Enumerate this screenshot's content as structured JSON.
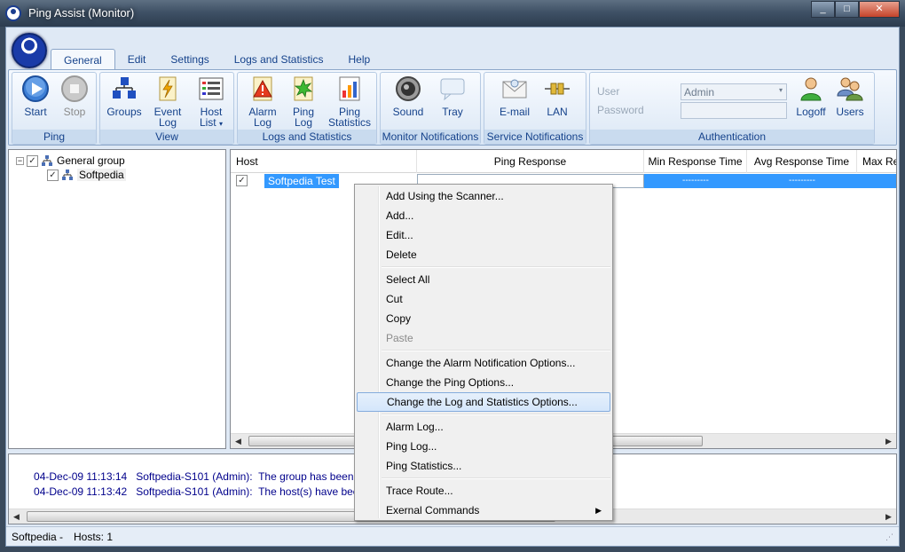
{
  "window": {
    "title": "Ping Assist  (Monitor)",
    "controls": [
      "_",
      "□",
      "✕"
    ]
  },
  "tabs": [
    {
      "label": "General",
      "active": true
    },
    {
      "label": "Edit"
    },
    {
      "label": "Settings"
    },
    {
      "label": "Logs and Statistics"
    },
    {
      "label": "Help"
    }
  ],
  "ribbon": {
    "groups": {
      "ping": "Ping",
      "view": "View",
      "logs": "Logs and Statistics",
      "monitor": "Monitor Notifications",
      "service": "Service Notifications",
      "auth": "Authentication"
    },
    "buttons": {
      "start": "Start",
      "stop": "Stop",
      "groups": "Groups",
      "event_log_1": "Event",
      "event_log_2": "Log",
      "host_list_1": "Host",
      "host_list_2": "List",
      "alarm_log_1": "Alarm",
      "alarm_log_2": "Log",
      "ping_log_1": "Ping",
      "ping_log_2": "Log",
      "ping_stats_1": "Ping",
      "ping_stats_2": "Statistics",
      "sound": "Sound",
      "tray": "Tray",
      "email": "E-mail",
      "lan": "LAN",
      "logoff": "Logoff",
      "users": "Users"
    },
    "auth": {
      "user_label": "User",
      "password_label": "Password",
      "user_value": "Admin",
      "password_value": ""
    }
  },
  "tree": {
    "root": "General group",
    "child": "Softpedia"
  },
  "grid": {
    "columns": [
      "Host",
      "Ping Response",
      "Min Response Time",
      "Avg Response Time",
      "Max Re"
    ],
    "rows": [
      {
        "host": "Softpedia Test",
        "ping_response": "",
        "min": "---------",
        "avg": "---------"
      }
    ]
  },
  "log": [
    {
      "time": "04-Dec-09 11:13:14",
      "user": "Softpedia-S101 (Admin):",
      "msg": "The group has been added."
    },
    {
      "time": "04-Dec-09 11:13:42",
      "user": "Softpedia-S101 (Admin):",
      "msg": "The host(s) have been added."
    }
  ],
  "status": {
    "left": "Softpedia -",
    "hosts": "Hosts: 1"
  },
  "context_menu": {
    "items": [
      "Add Using the Scanner...",
      "Add...",
      "Edit...",
      "Delete",
      "Select All",
      "Cut",
      "Copy",
      "Paste",
      "Change the Alarm Notification Options...",
      "Change the Ping Options...",
      "Change the Log and Statistics Options...",
      "Alarm Log...",
      "Ping Log...",
      "Ping Statistics...",
      "Trace Route...",
      "Exernal Commands"
    ]
  }
}
